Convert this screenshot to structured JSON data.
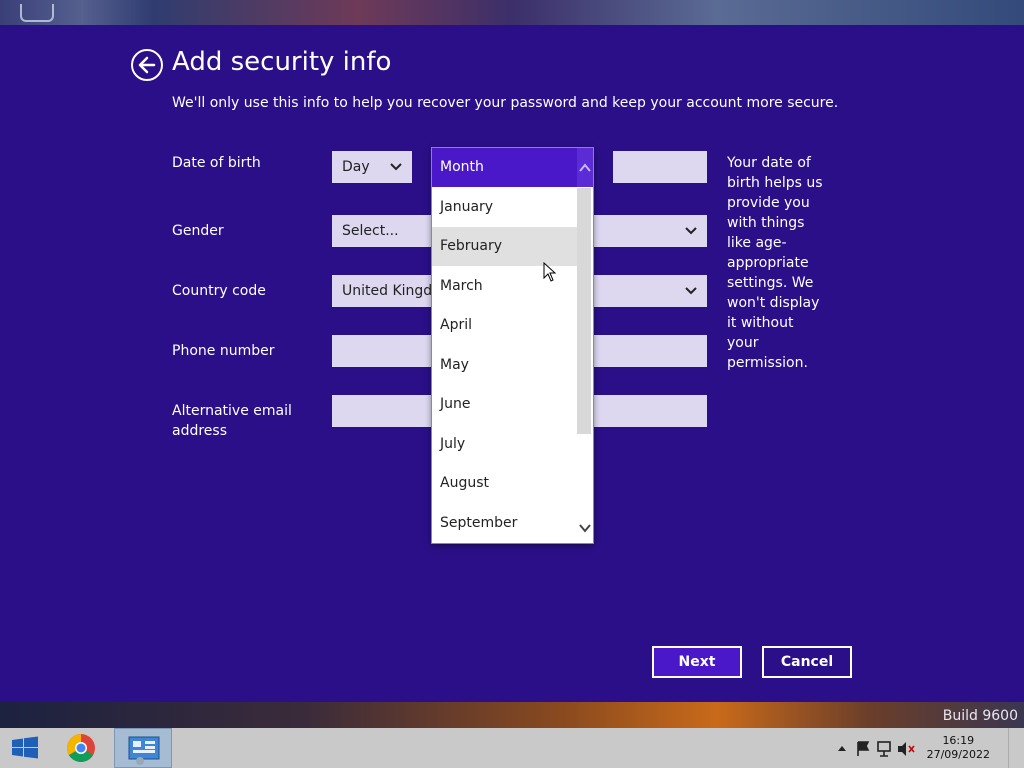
{
  "page": {
    "title": "Add security info",
    "subtitle": "We'll only use this info to help you recover your password and keep your account more secure."
  },
  "form": {
    "dob_label": "Date of birth",
    "day_value": "Day",
    "gender_label": "Gender",
    "gender_value": "Select...",
    "country_label": "Country code",
    "country_value": "United Kingdo",
    "phone_label": "Phone number",
    "alt_email_label_line1": "Alternative email",
    "alt_email_label_line2": "address"
  },
  "help_text": "Your date of birth helps us provide you with things like age-appropriate settings. We won't display it without your permission.",
  "dropdown": {
    "items": [
      "Month",
      "January",
      "February",
      "March",
      "April",
      "May",
      "June",
      "July",
      "August",
      "September"
    ],
    "selected": "Month",
    "hovered": "February"
  },
  "buttons": {
    "next": "Next",
    "cancel": "Cancel"
  },
  "watermark": "Build 9600",
  "taskbar": {
    "time": "16:19",
    "date": "27/09/2022"
  },
  "colors": {
    "background": "#2b0f88",
    "accent": "#4a18c8",
    "field": "#ddd8f0"
  }
}
